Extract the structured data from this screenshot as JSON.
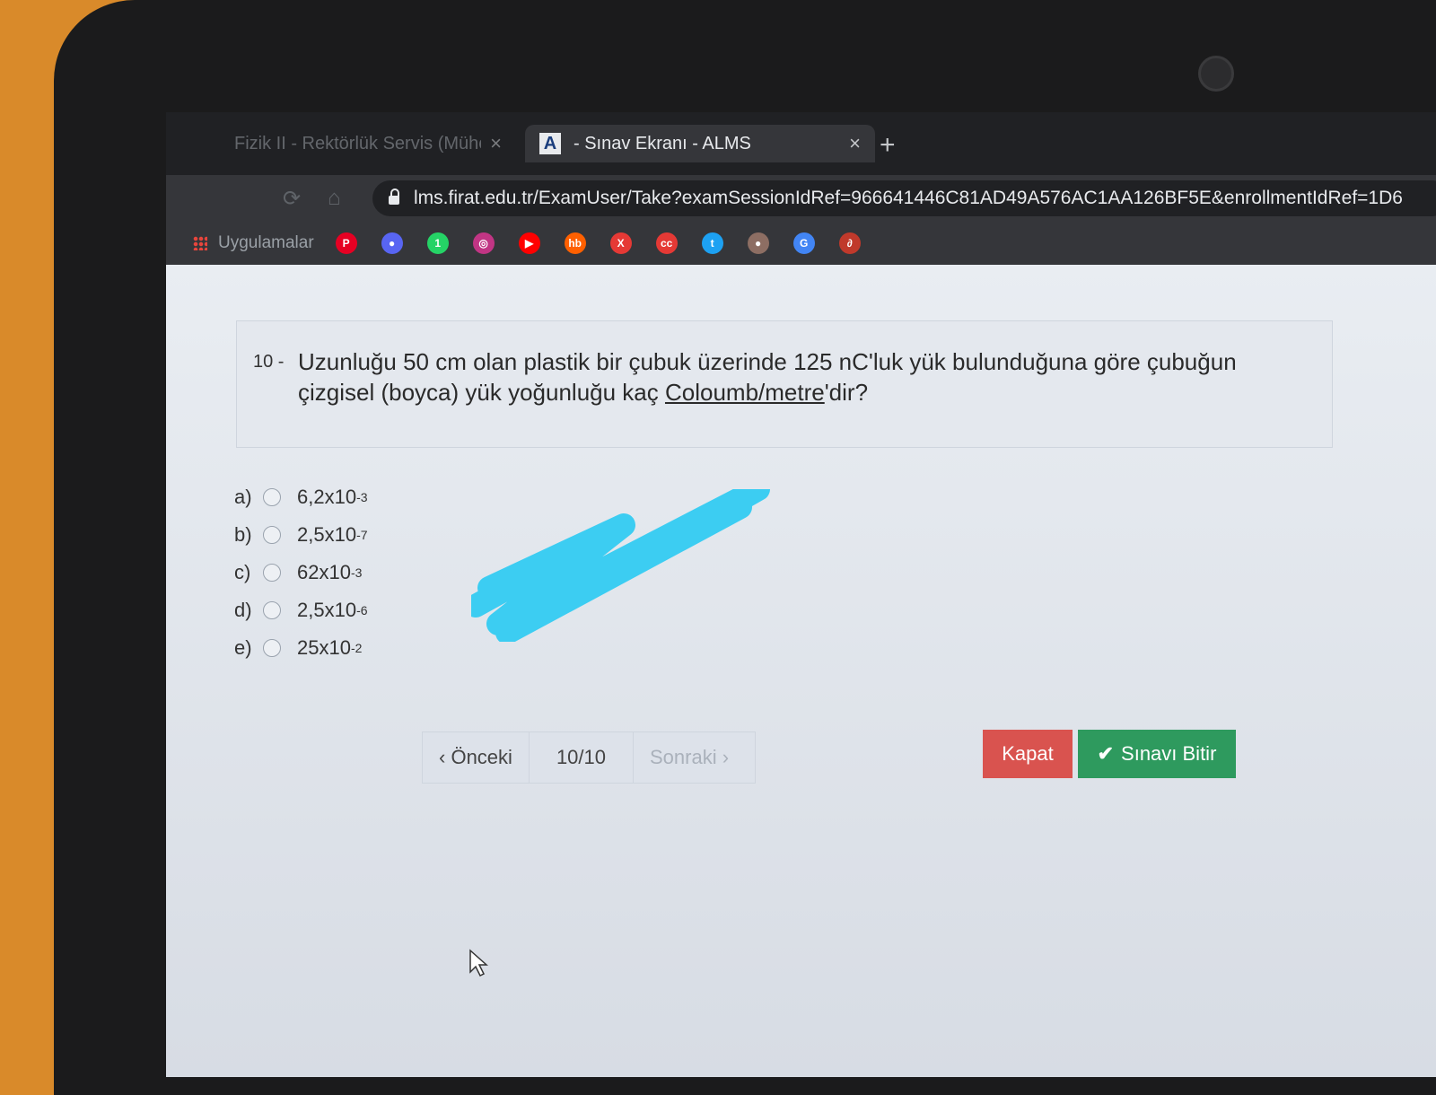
{
  "browser": {
    "tabs": [
      {
        "label": "Fizik II - Rektörlük Servis (Mühe",
        "close": "×",
        "active": false
      },
      {
        "icon_letter": "A",
        "label": "- Sınav Ekranı - ALMS",
        "close": "×",
        "active": true
      }
    ],
    "new_tab": "+",
    "url": "lms.firat.edu.tr/ExamUser/Take?examSessionIdRef=966641446C81AD49A576AC1AA126BF5E&enrollmentIdRef=1D6",
    "bookmarks_label": "Uygulamalar",
    "bookmark_icons": [
      {
        "name": "pinterest-icon",
        "color": "#e60023",
        "glyph": "P"
      },
      {
        "name": "discord-icon",
        "color": "#5865f2",
        "glyph": "●"
      },
      {
        "name": "whatsapp-icon",
        "color": "#25d366",
        "glyph": "1"
      },
      {
        "name": "instagram-icon",
        "color": "#c13584",
        "glyph": "◎"
      },
      {
        "name": "youtube-icon",
        "color": "#ff0000",
        "glyph": "▶"
      },
      {
        "name": "hb-icon",
        "color": "#ff6000",
        "glyph": "hb"
      },
      {
        "name": "x-icon",
        "color": "#e53935",
        "glyph": "X"
      },
      {
        "name": "cc-icon",
        "color": "#e53935",
        "glyph": "cc"
      },
      {
        "name": "twitter-icon",
        "color": "#1da1f2",
        "glyph": "t"
      },
      {
        "name": "bookmark-icon",
        "color": "#8d6e63",
        "glyph": "●"
      },
      {
        "name": "google-icon",
        "color": "#4285f4",
        "glyph": "G"
      },
      {
        "name": "link-icon",
        "color": "#c0392b",
        "glyph": "∂"
      }
    ]
  },
  "question": {
    "number": "10 -",
    "text_part1": "Uzunluğu 50 cm olan plastik bir çubuk üzerinde 125 nC'luk yük bulunduğuna göre çubuğun çizgisel (boyca) yük yoğunluğu kaç ",
    "text_underlined": "Coloumb/metre",
    "text_part2": "'dir?"
  },
  "options": [
    {
      "letter": "a)",
      "base": "6,2x10",
      "exp": "-3"
    },
    {
      "letter": "b)",
      "base": "2,5x10",
      "exp": "-7"
    },
    {
      "letter": "c)",
      "base": "62x10",
      "exp": "-3"
    },
    {
      "letter": "d)",
      "base": "2,5x10",
      "exp": "-6"
    },
    {
      "letter": "e)",
      "base": "25x10",
      "exp": "-2"
    }
  ],
  "pager": {
    "prev": "Önceki",
    "count": "10/10",
    "next": "Sonraki"
  },
  "actions": {
    "close": "Kapat",
    "finish": "Sınavı Bitir"
  },
  "colors": {
    "close": "#d9534f",
    "finish": "#2e9a5e",
    "scribble": "#3ccdf2"
  }
}
